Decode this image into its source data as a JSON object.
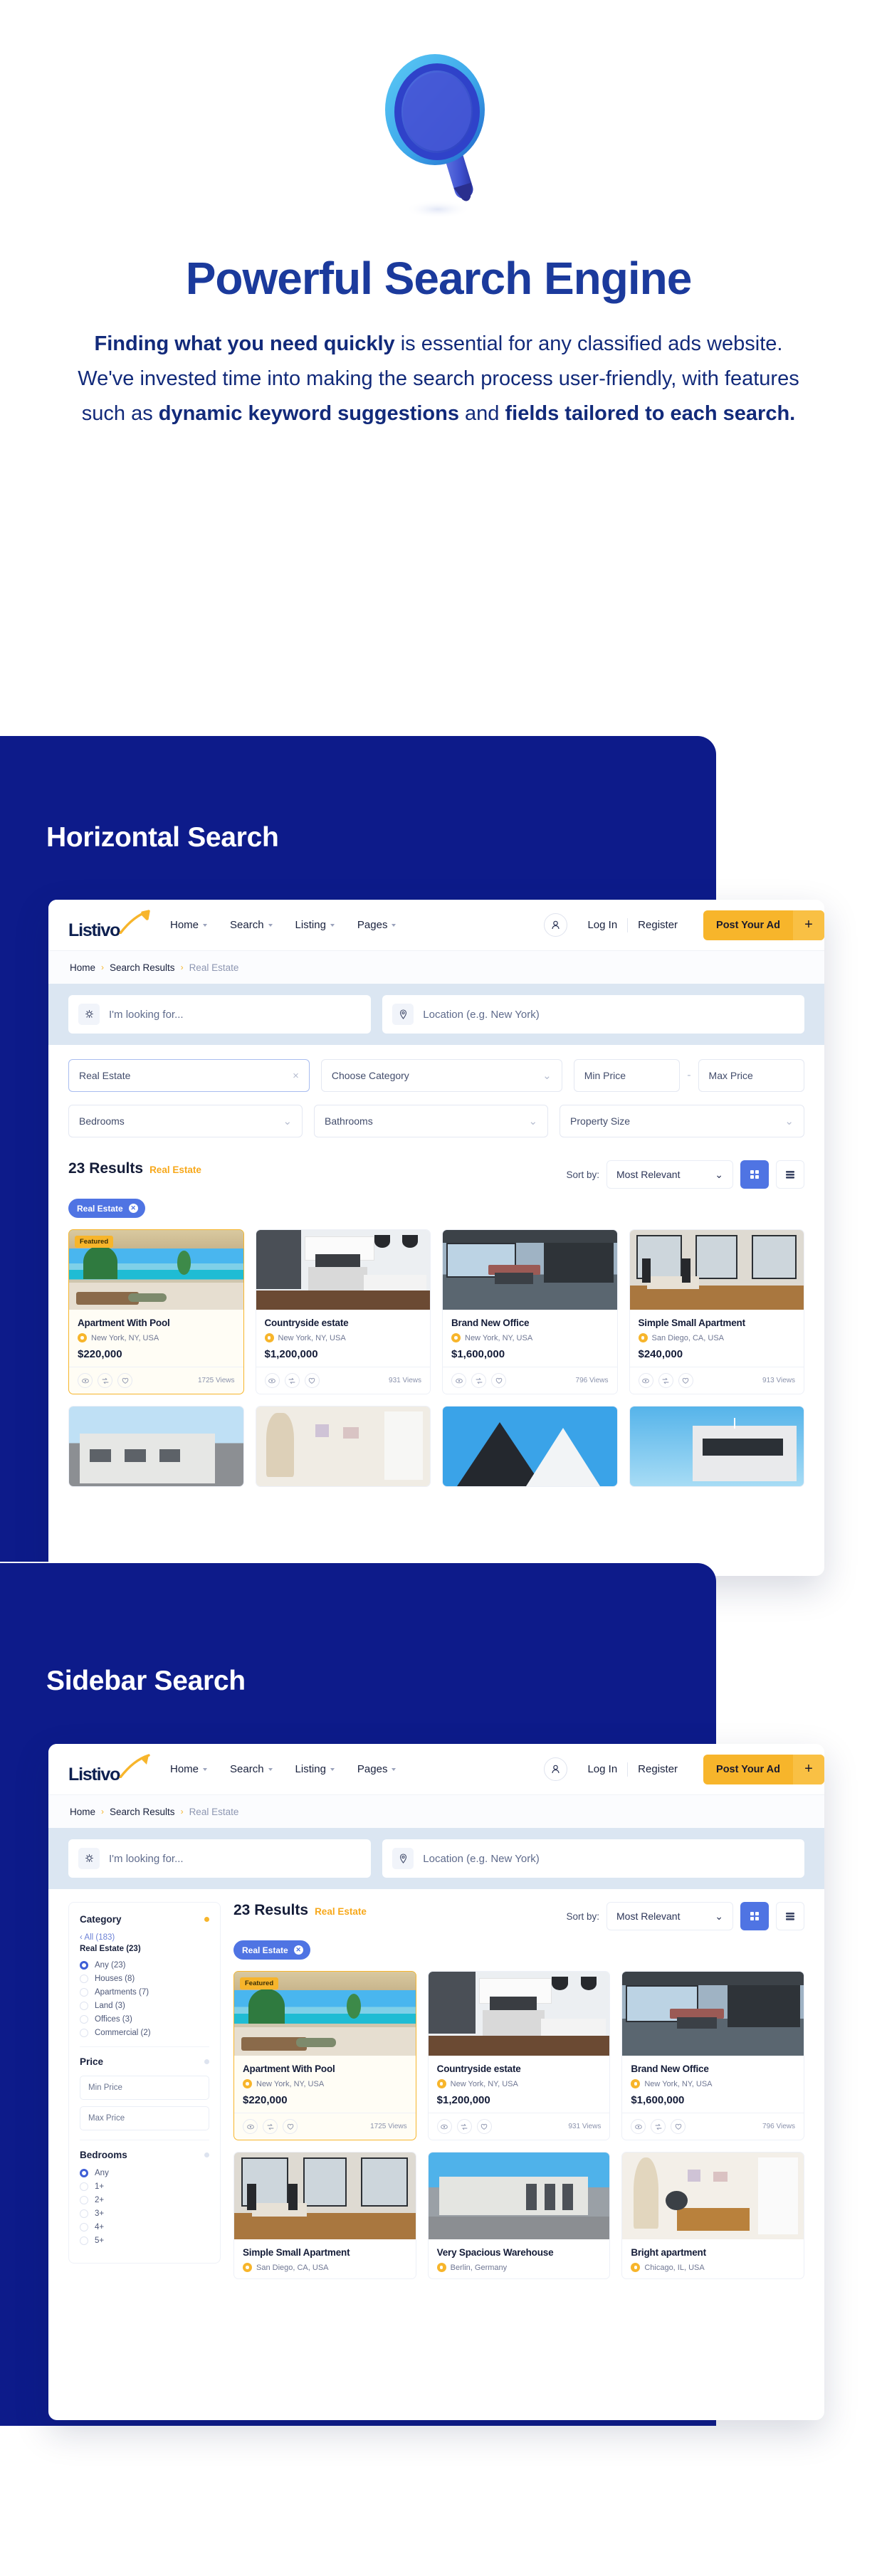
{
  "hero": {
    "icon": "magnifier-icon",
    "title": "Powerful Search Engine",
    "desc_1": "Finding what you need quickly",
    "desc_2": " is essential for any classified ads website. We've invested time into making the search process user-friendly, with features such as ",
    "desc_3": "dynamic keyword suggestions",
    "desc_4": " and ",
    "desc_5": "fields tailored to each search."
  },
  "sections": [
    {
      "title": "Horizontal Search"
    },
    {
      "title": "Sidebar Search"
    }
  ],
  "colors": {
    "brand_blue": "#1b3a9c",
    "panel_blue": "#0d1b8a",
    "accent_yellow": "#f7b52b",
    "accent_orange": "#f7a81b",
    "chip_blue": "#4f74e3",
    "search_band": "#dbe6f2"
  },
  "nav": {
    "logo": "Listivo",
    "links": [
      "Home",
      "Search",
      "Listing",
      "Pages"
    ],
    "login": "Log In",
    "register": "Register",
    "post_ad": "Post Your Ad",
    "post_ad_plus": "+",
    "avatar_icon": "user-icon"
  },
  "breadcrumb": {
    "items": [
      "Home",
      "Search Results",
      "Real Estate"
    ],
    "separator": "›"
  },
  "search": {
    "keyword_placeholder": "I'm looking for...",
    "keyword_icon": "lightbulb-icon",
    "location_placeholder": "Location (e.g. New York)",
    "location_icon": "map-pin-icon"
  },
  "filters_row1": [
    {
      "label": "Real Estate",
      "type": "clear",
      "glyph": "×",
      "active": true
    },
    {
      "label": "Choose Category",
      "type": "select",
      "glyph": "⌄",
      "active": false
    },
    {
      "label": "Min Price",
      "type": "text",
      "glyph": "",
      "active": false
    },
    {
      "label": "Max Price",
      "type": "text",
      "glyph": "",
      "active": false
    }
  ],
  "filters_row2": [
    {
      "label": "Bedrooms",
      "type": "select",
      "glyph": "⌄"
    },
    {
      "label": "Bathrooms",
      "type": "select",
      "glyph": "⌄"
    },
    {
      "label": "Property Size",
      "type": "select",
      "glyph": "⌄"
    }
  ],
  "price_dash": "-",
  "results": {
    "count_label": "23 Results",
    "category_label": "Real Estate",
    "sort_label": "Sort by:",
    "sort_value": "Most Relevant",
    "sort_options": [
      "Most Relevant"
    ],
    "chip_label": "Real Estate",
    "chip_close": "✕",
    "view_grid_icon": "grid-view-icon",
    "view_list_icon": "list-view-icon"
  },
  "listings": [
    {
      "title": "Apartment With Pool",
      "location": "New York, NY, USA",
      "price": "$220,000",
      "views": "1725 Views",
      "featured": true,
      "badge": "Featured",
      "img": "pool-resort"
    },
    {
      "title": "Countryside estate",
      "location": "New York, NY, USA",
      "price": "$1,200,000",
      "views": "931 Views",
      "featured": false,
      "badge": "",
      "img": "kitchen"
    },
    {
      "title": "Brand New Office",
      "location": "New York, NY, USA",
      "price": "$1,600,000",
      "views": "796 Views",
      "featured": false,
      "badge": "",
      "img": "office"
    },
    {
      "title": "Simple Small Apartment",
      "location": "San Diego, CA, USA",
      "price": "$240,000",
      "views": "913 Views",
      "featured": false,
      "badge": "",
      "img": "living"
    }
  ],
  "listings_row2": [
    {
      "img": "white-house"
    },
    {
      "img": "beige-room"
    },
    {
      "img": "dark-roof"
    },
    {
      "img": "modern-villa"
    }
  ],
  "listings_sidebar_row2": [
    {
      "title": "Simple Small Apartment",
      "location": "San Diego, CA, USA",
      "img": "living"
    },
    {
      "title": "Very Spacious Warehouse",
      "location": "Berlin, Germany",
      "img": "warehouse"
    },
    {
      "title": "Bright apartment",
      "location": "Chicago, IL, USA",
      "img": "bright"
    }
  ],
  "sidebar": {
    "category": {
      "title": "Category",
      "all_link": "All (183)",
      "all_caret": "‹",
      "current": "Real Estate (23)",
      "options": [
        "Any (23)",
        "Houses (8)",
        "Apartments (7)",
        "Land (3)",
        "Offices (3)",
        "Commercial (2)"
      ],
      "selected_index": 0
    },
    "price": {
      "title": "Price",
      "min_placeholder": "Min Price",
      "max_placeholder": "Max Price"
    },
    "bedrooms": {
      "title": "Bedrooms",
      "options": [
        "Any",
        "1+",
        "2+",
        "3+",
        "4+",
        "5+"
      ],
      "selected_index": 0
    }
  }
}
